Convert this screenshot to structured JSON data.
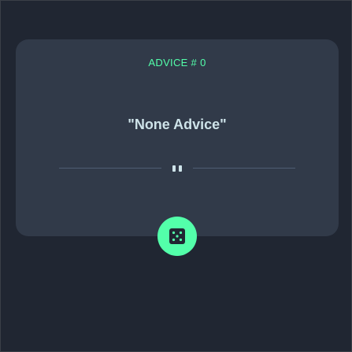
{
  "advice": {
    "label": "ADVICE #",
    "id": "0",
    "text": "\"None Advice\""
  },
  "icons": {
    "divider": "pause-divider-icon",
    "dice": "dice-icon"
  },
  "colors": {
    "background": "#202632",
    "card": "#313a49",
    "accent": "#53ffaa",
    "text": "#cee3e9",
    "divider": "#4f5d74"
  }
}
